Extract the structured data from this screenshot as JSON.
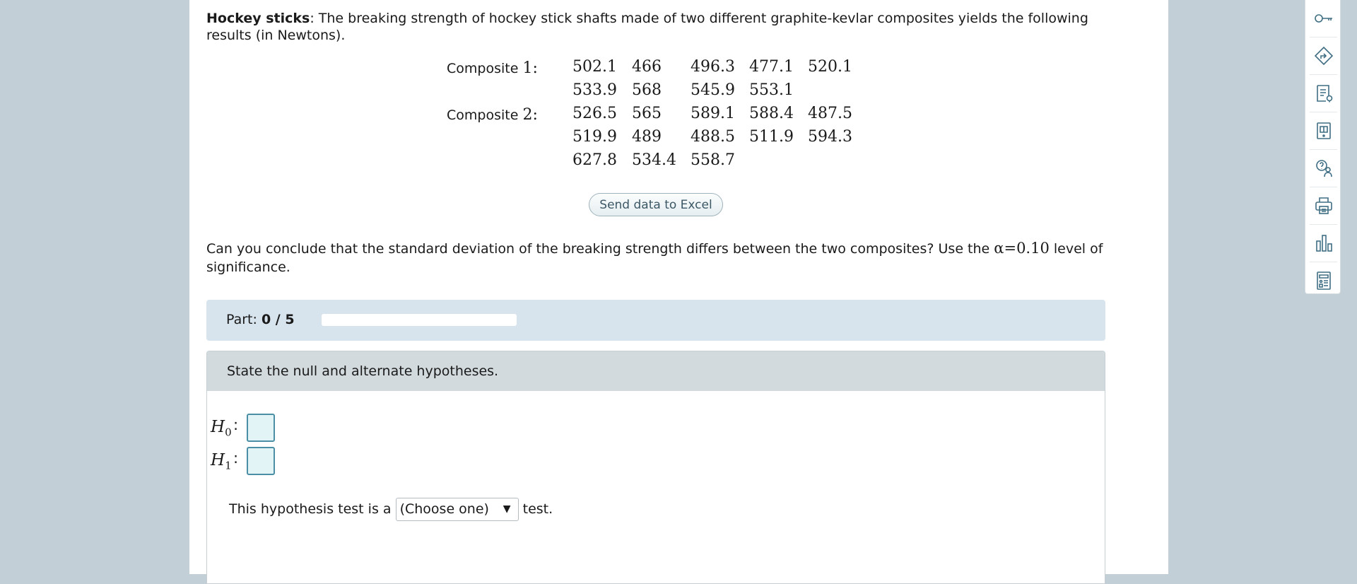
{
  "problem": {
    "title": "Hockey sticks",
    "text": ": The breaking strength of hockey stick shafts made of two different graphite-kevlar composites yields the following results (in Newtons)."
  },
  "data_table": {
    "composite1_label": "Composite",
    "composite1_num": "1",
    "composite2_label": "Composite",
    "composite2_num": "2",
    "colon": ":",
    "composite1": [
      [
        "502.1",
        "466",
        "496.3",
        "477.1",
        "520.1"
      ],
      [
        "533.9",
        "568",
        "545.9",
        "553.1"
      ]
    ],
    "composite2": [
      [
        "526.5",
        "565",
        "589.1",
        "588.4",
        "487.5"
      ],
      [
        "519.9",
        "489",
        "488.5",
        "511.9",
        "594.3"
      ],
      [
        "627.8",
        "534.4",
        "558.7"
      ]
    ]
  },
  "excel_button": "Send data to Excel",
  "question": {
    "text_before": "Can you conclude that the standard deviation of the breaking strength differs between the two composites? Use the ",
    "alpha_symbol": "α",
    "alpha_value": "=0.10",
    "text_after": " level of significance."
  },
  "part": {
    "label": "Part: ",
    "value": "0 / 5",
    "progress_fraction": 0
  },
  "step": {
    "heading": "State the null and alternate hypotheses.",
    "h0_letter": "H",
    "h0_sub": "0",
    "h1_letter": "H",
    "h1_sub": "1",
    "colon": ":",
    "test_text_before": "This hypothesis test is a",
    "test_select_value": "(Choose one)",
    "test_select_arrow": "▼",
    "test_text_after": "test."
  },
  "toolbar_icons": [
    "key-icon",
    "directions-icon",
    "notes-icon",
    "ebook-icon",
    "help-person-icon",
    "printer-icon",
    "bar-chart-icon",
    "calculator-icon"
  ],
  "colors": {
    "background": "#c2cfd6",
    "part_bar": "#d7e4ee",
    "step_header": "#d2dadd",
    "answer_box": "#e3f4f6",
    "accent": "#4a8fa6"
  }
}
